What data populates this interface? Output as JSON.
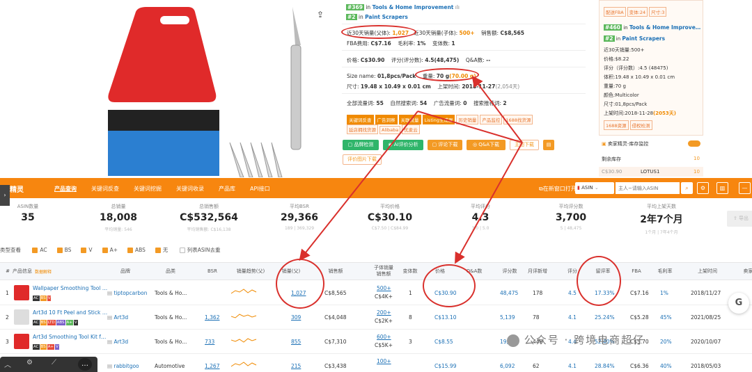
{
  "listing": {
    "rank1_num": "#369",
    "rank1_cat": "Tools & Home Improvement",
    "rank2_num": "#2",
    "rank2_cat": "Paint Scrapers",
    "rank_in": "in",
    "sales30_parent_label": "近30天销量(父体):",
    "sales30_parent_value": "1,027",
    "sales30_child_label": "近30天销量(子体):",
    "sales30_child_value": "500+",
    "revenue_label": "销售额:",
    "revenue_value": "C$8,565",
    "fba_label": "FBA费用:",
    "fba_value": "C$7.16",
    "margin_label": "毛利率:",
    "margin_value": "1%",
    "variants_label": "变体数:",
    "variants_value": "1",
    "price_label": "价格:",
    "price_value": "C$30.90",
    "rating_label": "评分(评分数):",
    "rating_value": "4.5(48,475)",
    "qa_label": "Q&A数:",
    "qa_value": "--",
    "size_label": "Size name:",
    "size_value": "01,8pcs/Pack",
    "weight_label": "重量:",
    "weight_value": "70 g",
    "weight_extra": "(70.00 g)",
    "dim_label": "尺寸:",
    "dim_value": "19.48 x 10.49 x 0.01 cm",
    "launch_label": "上架时间:",
    "launch_value": "2018-11-27",
    "launch_extra": "(2,054天)",
    "traffic_all_label": "全部流量词:",
    "traffic_all_value": "55",
    "traffic_nat_label": "自然搜索词:",
    "traffic_nat_value": "54",
    "traffic_ad_label": "广告流量词:",
    "traffic_ad_value": "0",
    "traffic_rec_label": "搜索推荐词:",
    "traffic_rec_value": "2",
    "keyword_tags": [
      "关键词反查",
      "广告洞察",
      "关联流量",
      "Listing生成器",
      "历史销量",
      "产品监控",
      "1688找货源"
    ],
    "keyword_tags2": [
      "延店拥找货源",
      "Alibaba",
      "优麦云"
    ],
    "btn_check": "品牌检测",
    "btn_ai": "AI评价分析",
    "btn_review_dl": "评论下载",
    "btn_qa_dl": "Q&A下载",
    "btn_img_dl": "主图下载",
    "btn_review_img": "评价图片下载"
  },
  "side": {
    "top_tags": [
      "配送FBA",
      "变体:24",
      "尺寸:3"
    ],
    "rank1_num": "#460",
    "rank1_cat": "Tools & Home Improve…",
    "rank2_num": "#2",
    "rank2_cat": "Paint Scrapers",
    "rank_in": "in",
    "lines": [
      "近30天销量:500+",
      "价格:$8.22",
      "评分（评分数）:4.5   (48475)",
      "体积:19.48 x 10.49 x 0.01 cm",
      "重量:70 g",
      "颜色:Multicolor",
      "尺寸:01,8pcs/Pack",
      "上架时间:2018-11-28"
    ],
    "launch_extra": "(2053天)",
    "tag_1688": "1688资源",
    "tag_risk": "侵权检测",
    "monitor_label": "卖家精灵-库存监控",
    "stock_label": "剩余库存",
    "stock_value": "10",
    "seller_price": "C$30.90",
    "seller_name": "LOTUS1",
    "seller_stock": "10"
  },
  "nav": {
    "brand": "家精灵",
    "items": [
      "产品查询",
      "关键词反查",
      "关键词挖掘",
      "关键词收录",
      "产品库",
      "API接口"
    ],
    "open_new": "在新窗口打开",
    "market": "ASIN",
    "search_placeholder": "主人~请输入ASIN"
  },
  "stats": [
    {
      "label": "ASIN数量",
      "value": "35",
      "sub": ""
    },
    {
      "label": "总销量",
      "value": "18,008",
      "sub": "平均销量: 546"
    },
    {
      "label": "总销售额",
      "value": "C$532,564",
      "sub": "平均销售额: C$16,138"
    },
    {
      "label": "平均BSR",
      "value": "29,366",
      "sub": "189 | 369,329"
    },
    {
      "label": "平均价格",
      "value": "C$30.10",
      "sub": "C$7.50 | C$84.99"
    },
    {
      "label": "平均评分",
      "value": "4.3",
      "sub": "3.0 | 5.0"
    },
    {
      "label": "平均评分数",
      "value": "3,700",
      "sub": "5 | 48,475"
    },
    {
      "label": "平均上架天数",
      "value": "2年7个月",
      "sub": "1个月 | 7年4个月"
    }
  ],
  "filter": {
    "label": "类型查看",
    "items": [
      "AC",
      "BS",
      "V",
      "A+",
      "ABS",
      "无"
    ],
    "dedupe": "列表ASIN去重"
  },
  "table": {
    "headers": [
      "#",
      "产品信息",
      "品牌",
      "品类",
      "BSR",
      "销量趋势(父)",
      "销量(父)",
      "销售额",
      "子体销量\n销售额",
      "变体数",
      "价格",
      "Q&A数",
      "评分数",
      "月评新增",
      "评分",
      "留评率",
      "FBA",
      "毛利率",
      "上架时间",
      "卖家数"
    ],
    "info_sub": "数据解释",
    "rows": [
      {
        "idx": "1",
        "title": "Wallpaper Smoothing Tool …",
        "brand": "tiptopcarbon",
        "cat": "Tools & Ho...",
        "bsr": "",
        "sales": "1,027",
        "revenue": "C$8,565",
        "child_sales": "500+",
        "child_rev": "C$4K+",
        "variants": "1",
        "price": "C$30.90",
        "qa": "",
        "reviews": "48,475",
        "monthly": "178",
        "rating": "4.5",
        "rate": "17.33%",
        "fba": "C$7.16",
        "margin": "1%",
        "date": "2018/11/27"
      },
      {
        "idx": "2",
        "title": "Art3d 10 Ft Peel and Stick …",
        "brand": "Art3d",
        "cat": "Tools & Ho...",
        "bsr": "1,362",
        "sales": "309",
        "revenue": "C$4,048",
        "child_sales": "200+",
        "child_rev": "C$2K+",
        "variants": "8",
        "price": "C$13.10",
        "qa": "",
        "reviews": "5,139",
        "monthly": "78",
        "rating": "4.1",
        "rate": "25.24%",
        "fba": "C$5.28",
        "margin": "45%",
        "date": "2021/08/25"
      },
      {
        "idx": "3",
        "title": "Art3d Smoothing Tool Kit f…",
        "brand": "Art3d",
        "cat": "Tools & Ho...",
        "bsr": "733",
        "sales": "855",
        "revenue": "C$7,310",
        "child_sales": "600+",
        "child_rev": "C$5K+",
        "variants": "3",
        "price": "C$8.55",
        "qa": "",
        "reviews": "19,022",
        "monthly": "448",
        "rating": "4.4",
        "rate": "52.40%",
        "fba": "C$5.70",
        "margin": "20%",
        "date": "2020/10/07"
      },
      {
        "idx": "4",
        "title": "",
        "brand": "rabbitgoo",
        "cat": "Automotive",
        "bsr": "1,267",
        "sales": "215",
        "revenue": "C$3,438",
        "child_sales": "100+",
        "child_rev": "",
        "variants": "",
        "price": "C$15.99",
        "qa": "",
        "reviews": "6,092",
        "monthly": "62",
        "rating": "4.1",
        "rate": "28.84%",
        "fba": "C$6.36",
        "margin": "40%",
        "date": "2018/05/03"
      }
    ]
  },
  "watermark": "公众号 · 跨境电商超仔",
  "colors": {
    "orange": "#f7860f",
    "green": "#2fb56a",
    "red": "#d9302c",
    "blue": "#1a6fb5"
  }
}
